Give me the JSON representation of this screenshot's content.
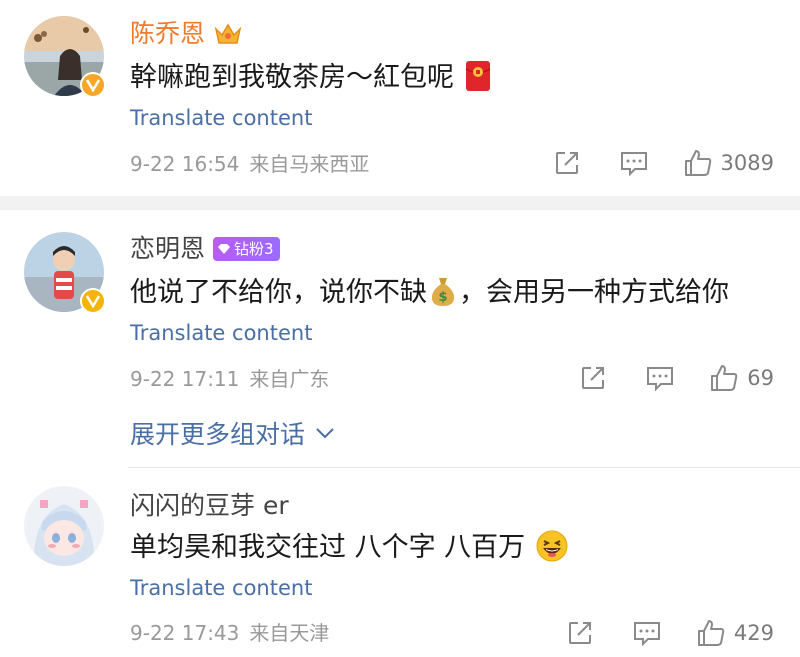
{
  "comments": [
    {
      "username": "陈乔恩",
      "text": "幹嘛跑到我敬茶房～紅包呢",
      "translate_label": "Translate content",
      "date": "9-22 16:54",
      "location": "来自马来西亚",
      "likes": "3089",
      "badge_icon": "crown-icon",
      "emoji_icon": "red-envelope-icon"
    },
    {
      "username": "恋明恩",
      "fan_badge": "钻粉3",
      "text_before": "他说了不给你，说你不缺",
      "text_after": "，会用另一种方式给你",
      "translate_label": "Translate content",
      "date": "9-22 17:11",
      "location": "来自广东",
      "likes": "69",
      "emoji_icon": "money-bag-icon"
    },
    {
      "username": "闪闪的豆芽 er",
      "text": "单均昊和我交往过 八个字 八百万",
      "translate_label": "Translate content",
      "date": "9-22 17:43",
      "location": "来自天津",
      "likes": "429",
      "emoji_icon": "laughing-face-icon"
    }
  ],
  "expand_more": "展开更多组对话",
  "colors": {
    "vip_name": "#ef7b2b",
    "link": "#4a6fa5",
    "meta": "#999999",
    "separator": "#f2f2f2"
  }
}
